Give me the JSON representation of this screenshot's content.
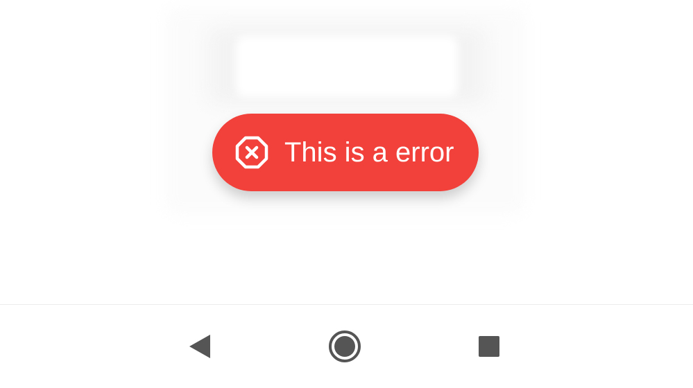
{
  "toast": {
    "message": "This is a error",
    "icon": "error-octagon-x-icon",
    "background_color": "#f2413a",
    "text_color": "#ffffff"
  },
  "nav_bar": {
    "buttons": [
      {
        "icon": "back-triangle-icon"
      },
      {
        "icon": "home-circle-icon"
      },
      {
        "icon": "recents-square-icon"
      }
    ],
    "icon_color": "#555555"
  }
}
